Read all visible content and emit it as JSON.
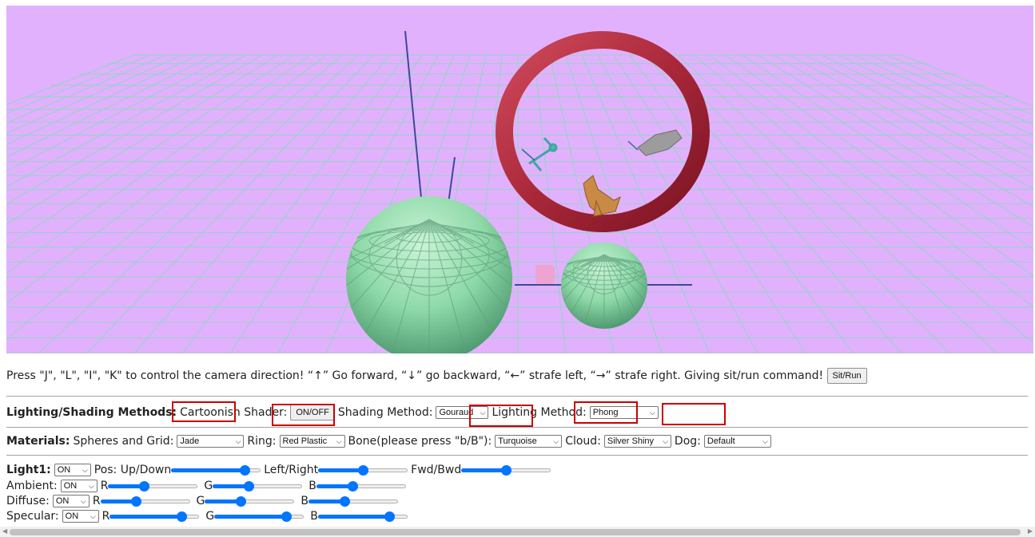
{
  "instructions": {
    "text": "Press \"J\", \"L\", \"I\", \"K\" to control the camera direction!  “↑”  Go forward,  “↓”  go backward,  “←”  strafe left,  “→”  strafe right. Giving sit/run command!",
    "sit_run_label": "Sit/Run"
  },
  "lighting": {
    "heading": "Lighting/Shading Methods:",
    "cartoon_label": "Cartoonish Shader:",
    "cartoon_button": "ON/OFF",
    "shading_label": "Shading Method:",
    "shading_value": "Gouraud",
    "lighting_label": "Lighting Method:",
    "lighting_value": "Phong"
  },
  "materials": {
    "heading": "Materials:",
    "spheres_label": "Spheres and Grid:",
    "spheres_value": "Jade",
    "ring_label": "Ring:",
    "ring_value": "Red Plastic",
    "bone_label": "Bone(please press \"b/B\"):",
    "bone_value": "Turquoise",
    "cloud_label": "Cloud:",
    "cloud_value": "Silver Shiny",
    "dog_label": "Dog:",
    "dog_value": "Default"
  },
  "light1": {
    "heading": "Light1:",
    "state": "ON",
    "pos_label": "Pos: Up/Down",
    "pos_updown": 0.82,
    "leftright_label": "Left/Right",
    "pos_leftright": 0.5,
    "fwdbwd_label": "Fwd/Bwd",
    "pos_fwdbwd": 0.5,
    "ambient_label": "Ambient:",
    "ambient_state": "ON",
    "ambient": [
      0.4,
      0.4,
      0.4
    ],
    "diffuse_label": "Diffuse:",
    "diffuse_state": "ON",
    "diffuse": [
      0.4,
      0.4,
      0.4
    ],
    "specular_label": "Specular:",
    "specular_state": "ON",
    "specular": [
      0.8,
      0.8,
      0.8
    ],
    "r_label": "R",
    "g_label": "G",
    "b_label": "B"
  },
  "colors": {
    "scene_bg": "#e2b1fd",
    "grid": "#8fd6c4",
    "sphere": "#8ed9a8",
    "ring": "#a82839",
    "slider_accent": "#0075ff",
    "annotation_box": "#cc0000"
  }
}
